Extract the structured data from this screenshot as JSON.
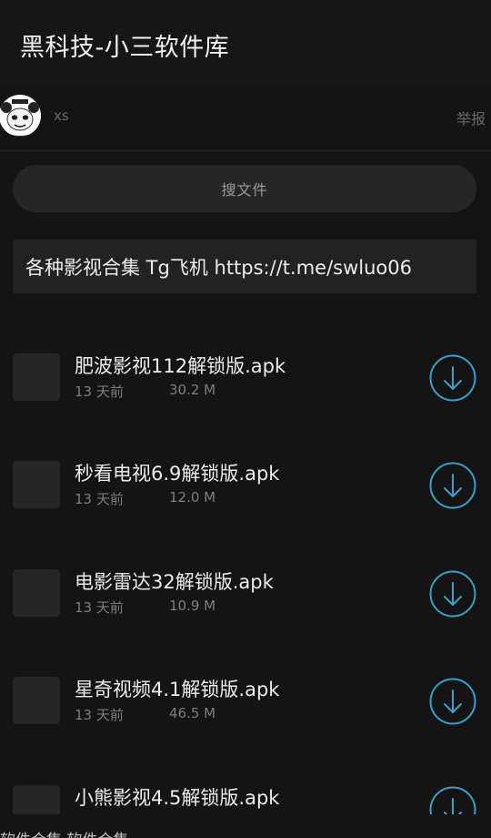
{
  "header": {
    "title": "黑科技-小三软件库"
  },
  "user": {
    "name": "xs",
    "report_label": "举报"
  },
  "search": {
    "label": "搜文件"
  },
  "notice": {
    "text": "各种影视合集 Tg飞机 https://t.me/swluo06"
  },
  "files": [
    {
      "name": "肥波影视112解锁版.apk",
      "time": "13 天前",
      "size": "30.2 M"
    },
    {
      "name": "秒看电视6.9解锁版.apk",
      "time": "13 天前",
      "size": "12.0 M"
    },
    {
      "name": "电影雷达32解锁版.apk",
      "time": "13 天前",
      "size": "10.9 M"
    },
    {
      "name": "星奇视频4.1解锁版.apk",
      "time": "13 天前",
      "size": "46.5 M"
    },
    {
      "name": "小熊影视4.5解锁版.apk",
      "time": "",
      "size": ""
    }
  ],
  "footer": {
    "partial_text": "软件合集    软件合集"
  },
  "colors": {
    "accent": "#3aa0c8",
    "background": "#141414",
    "surface": "#262626"
  },
  "icons": {
    "download": "download-circle-icon",
    "avatar": "panda-meme-avatar"
  }
}
